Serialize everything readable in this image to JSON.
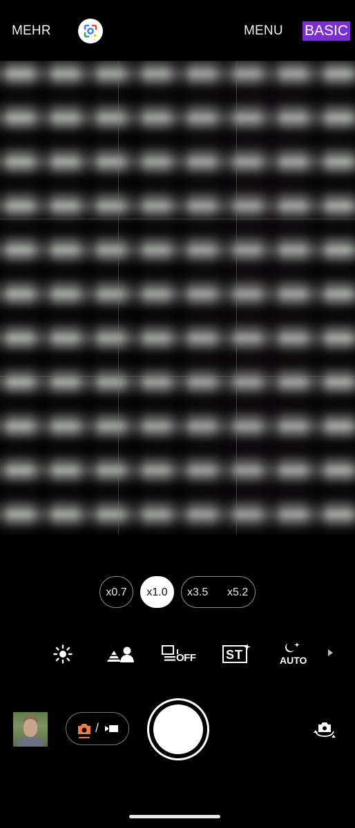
{
  "topbar": {
    "more_label": "MEHR",
    "menu_label": "MENU",
    "basic_label": "BASIC",
    "lens_icon": "google-lens-icon",
    "basic_bg": "#7b2fd2"
  },
  "zoom": {
    "options": [
      "x0.7",
      "x1.0",
      "x3.5",
      "x5.2"
    ],
    "selected": "x1.0"
  },
  "modes": {
    "items": [
      {
        "icon": "brightness-icon"
      },
      {
        "icon": "scene-portrait-icon"
      },
      {
        "icon": "drive-mode-icon",
        "label": "OFF"
      },
      {
        "icon": "style-icon",
        "label": "ST"
      },
      {
        "icon": "night-mode-icon",
        "label": "AUTO"
      }
    ],
    "more_icon": "chevron-right-icon"
  },
  "controls": {
    "thumbnail": "last-photo-thumbnail",
    "mode_switch": {
      "photo_icon": "camera-icon",
      "video_icon": "video-icon",
      "separator": "/",
      "accent": "#f07a45"
    },
    "shutter": "shutter-button",
    "flip_icon": "switch-camera-icon"
  }
}
